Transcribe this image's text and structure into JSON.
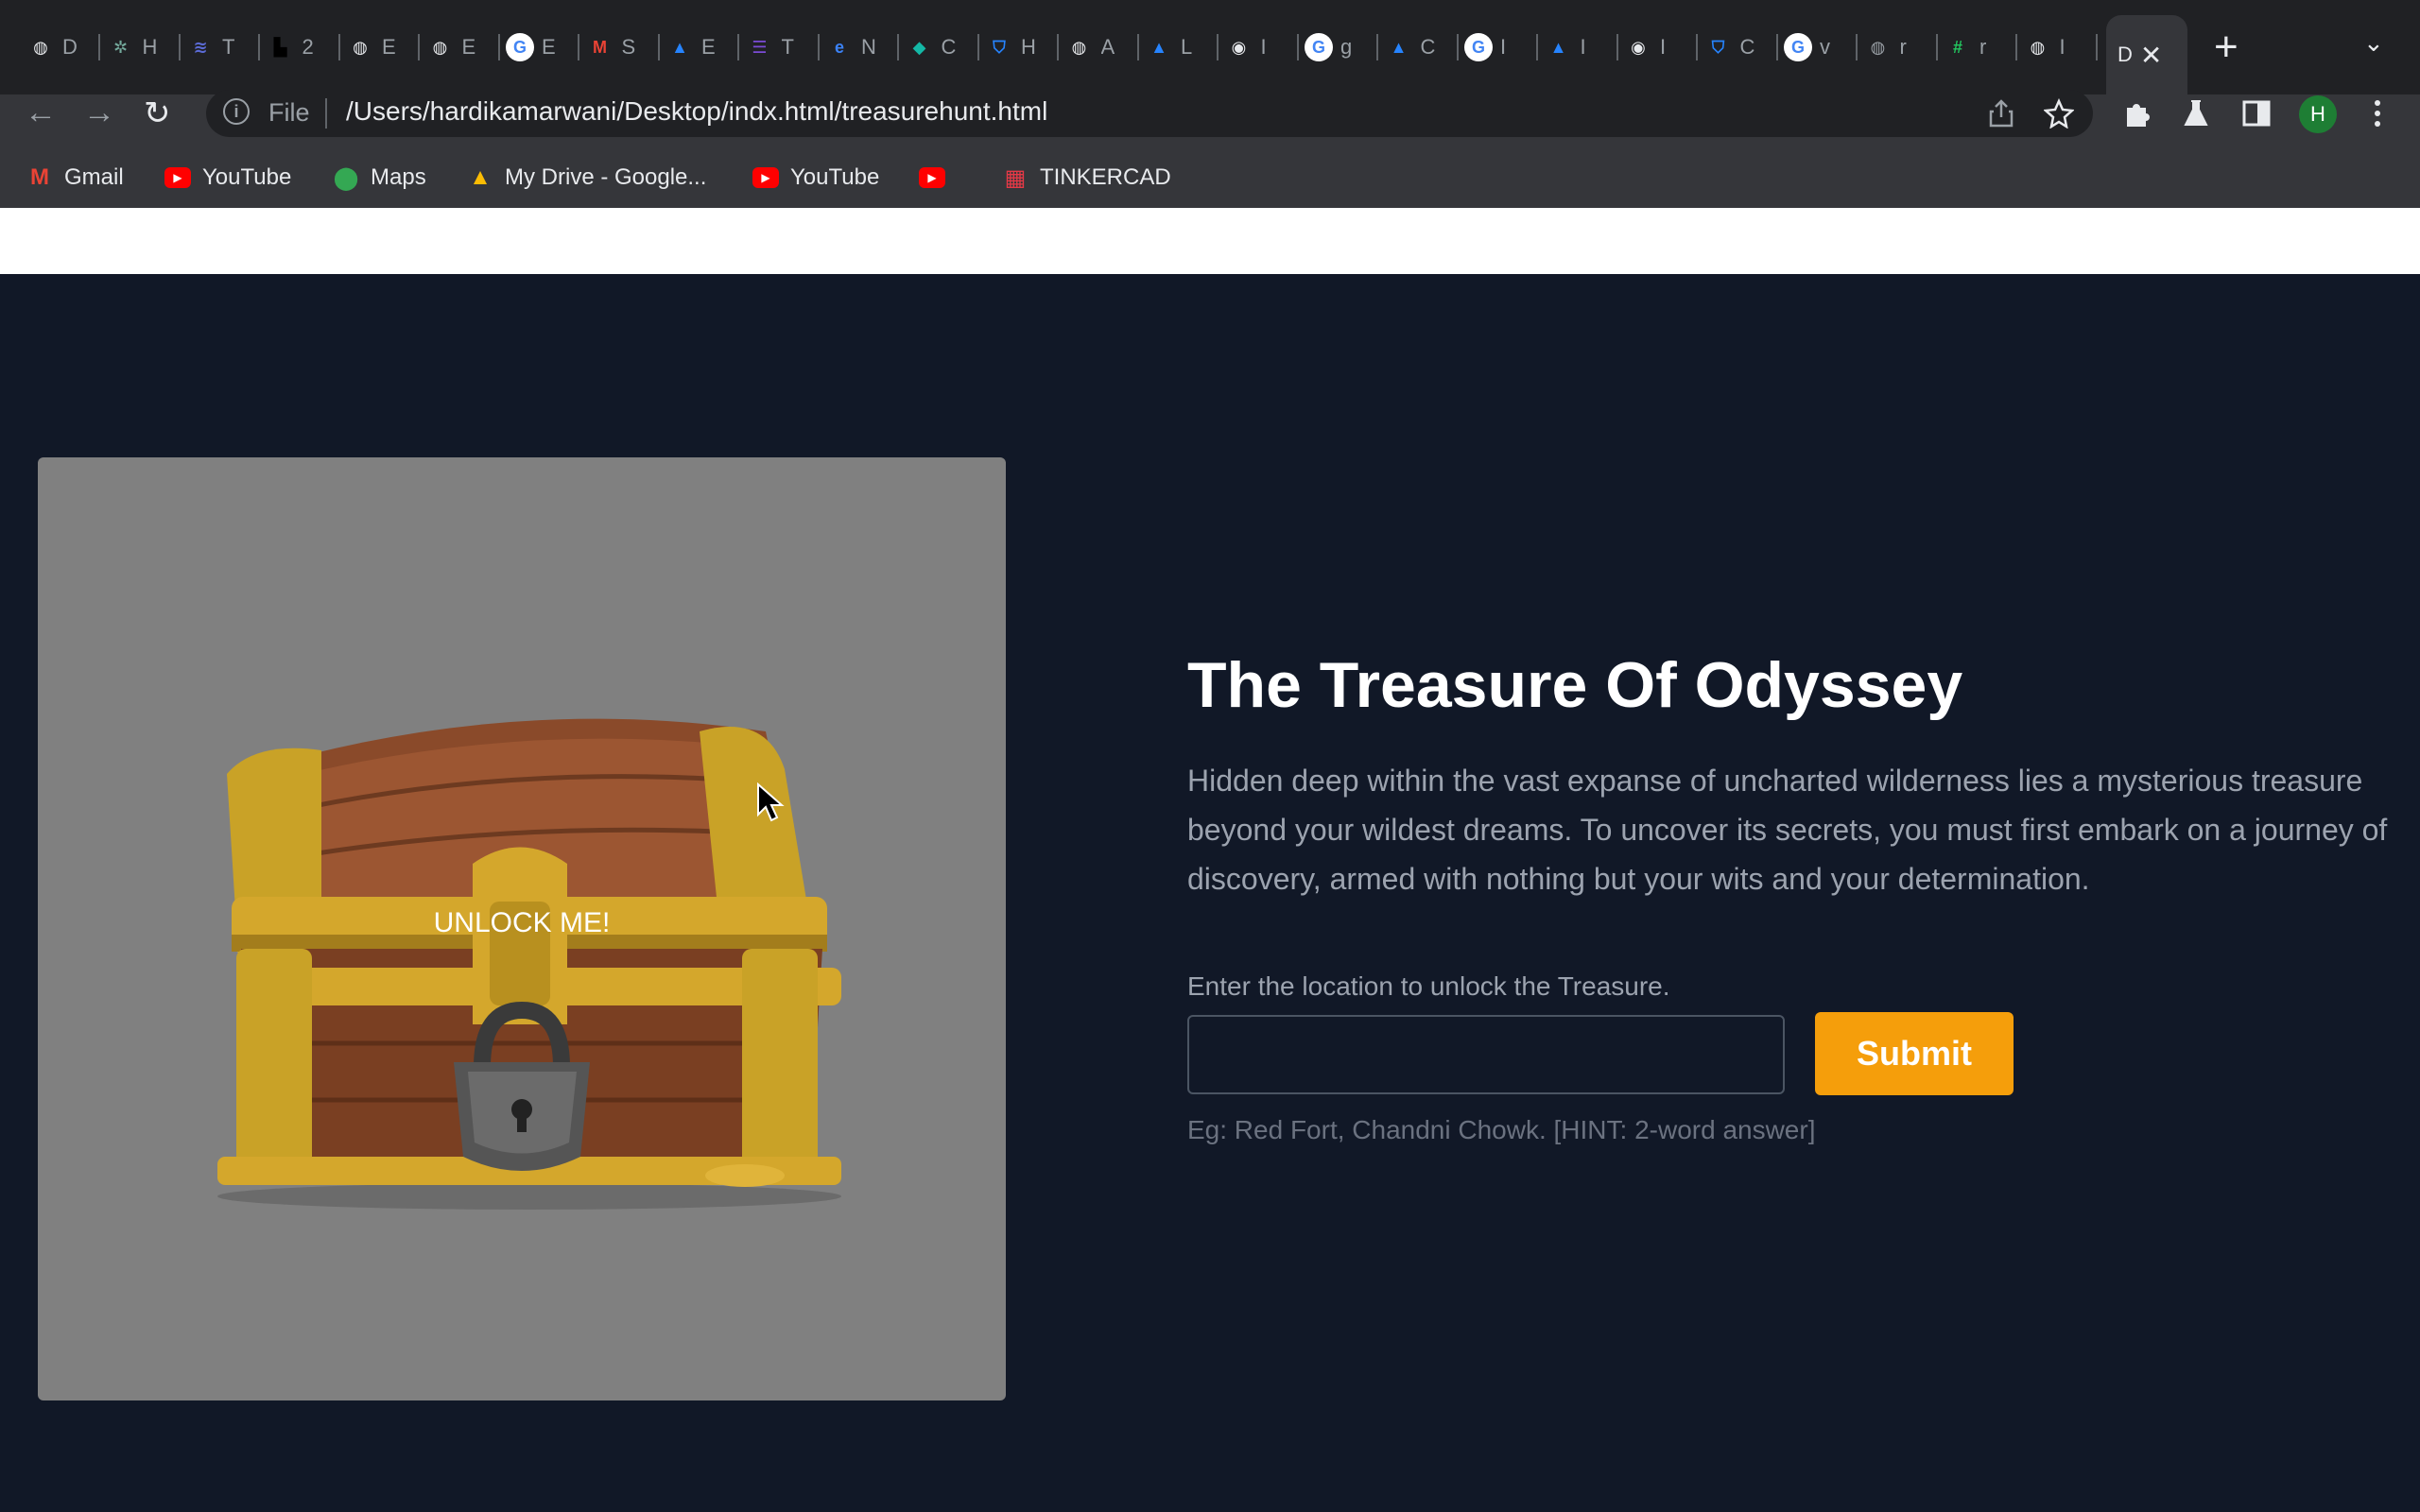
{
  "browser": {
    "tabs": [
      {
        "letter": "D",
        "icon": "globe-icon",
        "color": "#e8eaed"
      },
      {
        "letter": "H",
        "icon": "chatgpt-icon",
        "color": "#74aa9c"
      },
      {
        "letter": "T",
        "icon": "stack-icon",
        "color": "#5b6bd6"
      },
      {
        "letter": "2",
        "icon": "blocks-icon",
        "color": "#000000"
      },
      {
        "letter": "E",
        "icon": "globe-icon",
        "color": "#e8eaed"
      },
      {
        "letter": "E",
        "icon": "globe-icon",
        "color": "#e8eaed"
      },
      {
        "letter": "E",
        "icon": "google-icon",
        "color": "#ffffff"
      },
      {
        "letter": "S",
        "icon": "gmail-icon",
        "color": "#ea4335"
      },
      {
        "letter": "E",
        "icon": "atlassian-icon",
        "color": "#2684ff"
      },
      {
        "letter": "T",
        "icon": "list-icon",
        "color": "#7b4bd6"
      },
      {
        "letter": "N",
        "icon": "edge-icon",
        "color": "#3b82f6"
      },
      {
        "letter": "C",
        "icon": "diamond-icon",
        "color": "#14b8a6"
      },
      {
        "letter": "H",
        "icon": "shield-icon",
        "color": "#2684ff"
      },
      {
        "letter": "A",
        "icon": "globe-icon",
        "color": "#e8eaed"
      },
      {
        "letter": "L",
        "icon": "atlassian-icon",
        "color": "#2684ff"
      },
      {
        "letter": "I",
        "icon": "chrome-icon",
        "color": "#e8eaed"
      },
      {
        "letter": "g",
        "icon": "google-icon",
        "color": "#ffffff"
      },
      {
        "letter": "C",
        "icon": "atlassian-icon",
        "color": "#2684ff"
      },
      {
        "letter": "I",
        "icon": "google-icon",
        "color": "#ffffff"
      },
      {
        "letter": "I",
        "icon": "atlassian-icon",
        "color": "#2684ff"
      },
      {
        "letter": "I",
        "icon": "chrome-icon",
        "color": "#e8eaed"
      },
      {
        "letter": "C",
        "icon": "shield-icon",
        "color": "#2684ff"
      },
      {
        "letter": "v",
        "icon": "google-icon",
        "color": "#ffffff"
      },
      {
        "letter": "r",
        "icon": "globe-icon",
        "color": "#9aa0a6"
      },
      {
        "letter": "r",
        "icon": "hash-icon",
        "color": "#22c55e"
      },
      {
        "letter": "I",
        "icon": "globe-icon",
        "color": "#e8eaed"
      }
    ],
    "active_tab": {
      "letter": "D",
      "close": "✕"
    },
    "new_tab": "+",
    "tab_menu": "⌄",
    "nav": {
      "back": "←",
      "forward": "→",
      "reload": "↻"
    },
    "omnibox": {
      "info": "i",
      "scheme_label": "File",
      "url": "/Users/hardikamarwani/Desktop/indx.html/treasurehunt.html"
    },
    "profile_initial": "H",
    "bookmarks": [
      {
        "label": "Gmail",
        "icon": "gmail-icon",
        "color": "#ea4335"
      },
      {
        "label": "YouTube",
        "icon": "youtube-icon",
        "color": "#ff0000"
      },
      {
        "label": "Maps",
        "icon": "maps-icon",
        "color": "#34a853"
      },
      {
        "label": "My Drive - Google...",
        "icon": "drive-icon",
        "color": "#fbbc04"
      },
      {
        "label": "YouTube",
        "icon": "youtube-icon",
        "color": "#ff0000"
      },
      {
        "label": "",
        "icon": "youtube-icon",
        "color": "#ff0000"
      },
      {
        "label": "TINKERCAD",
        "icon": "tinkercad-icon",
        "color": "#e63946"
      }
    ]
  },
  "page": {
    "chest_label": "UNLOCK ME!",
    "title": "The Treasure Of Odyssey",
    "description": "Hidden deep within the vast expanse of uncharted wilderness lies a mysterious treasure beyond your wildest dreams. To uncover its secrets, you must first embark on a journey of discovery, armed with nothing but your wits and your determination.",
    "prompt": "Enter the location to unlock the Treasure.",
    "input_value": "",
    "submit_label": "Submit",
    "hint": "Eg: Red Fort, Chandni Chowk. [HINT: 2-word answer]",
    "colors": {
      "background": "#111827",
      "accent": "#f59e0b",
      "card": "#808080"
    }
  }
}
